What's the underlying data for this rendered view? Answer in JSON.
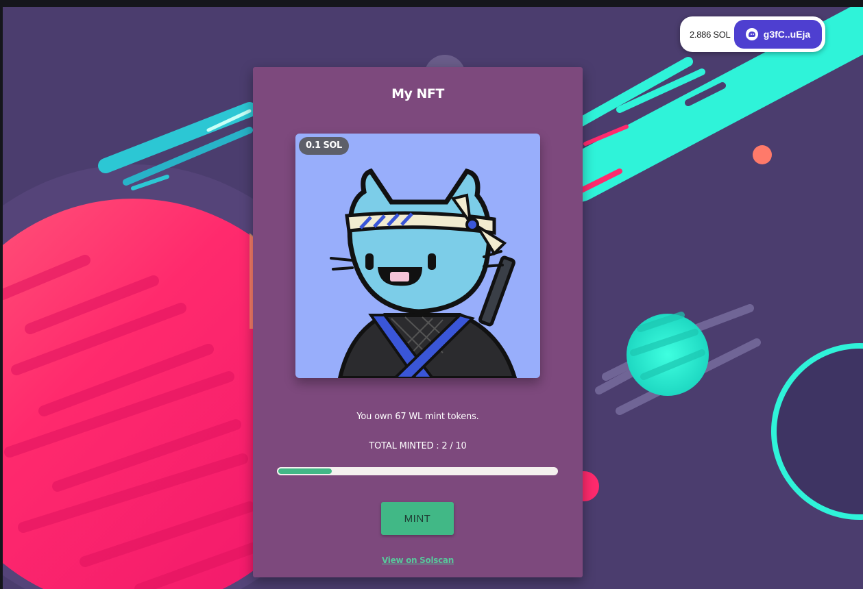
{
  "wallet": {
    "balance": "2.886 SOL",
    "address": "g3fC..uEja",
    "icon": "phantom-ghost-icon"
  },
  "card": {
    "title": "My NFT",
    "price_badge": "0.1 SOL",
    "own_text": "You own 67 WL mint tokens.",
    "minted_text": "TOTAL MINTED : 2 / 10",
    "minted_progress": 0.2,
    "mint_label": "MINT",
    "solscan_label": "View on Solscan"
  },
  "colors": {
    "background": "#4b3d6e",
    "card": "#7d497d",
    "accent_green": "#41b886",
    "wallet_button": "#4e3fd0",
    "nft_background": "#98aefb"
  }
}
